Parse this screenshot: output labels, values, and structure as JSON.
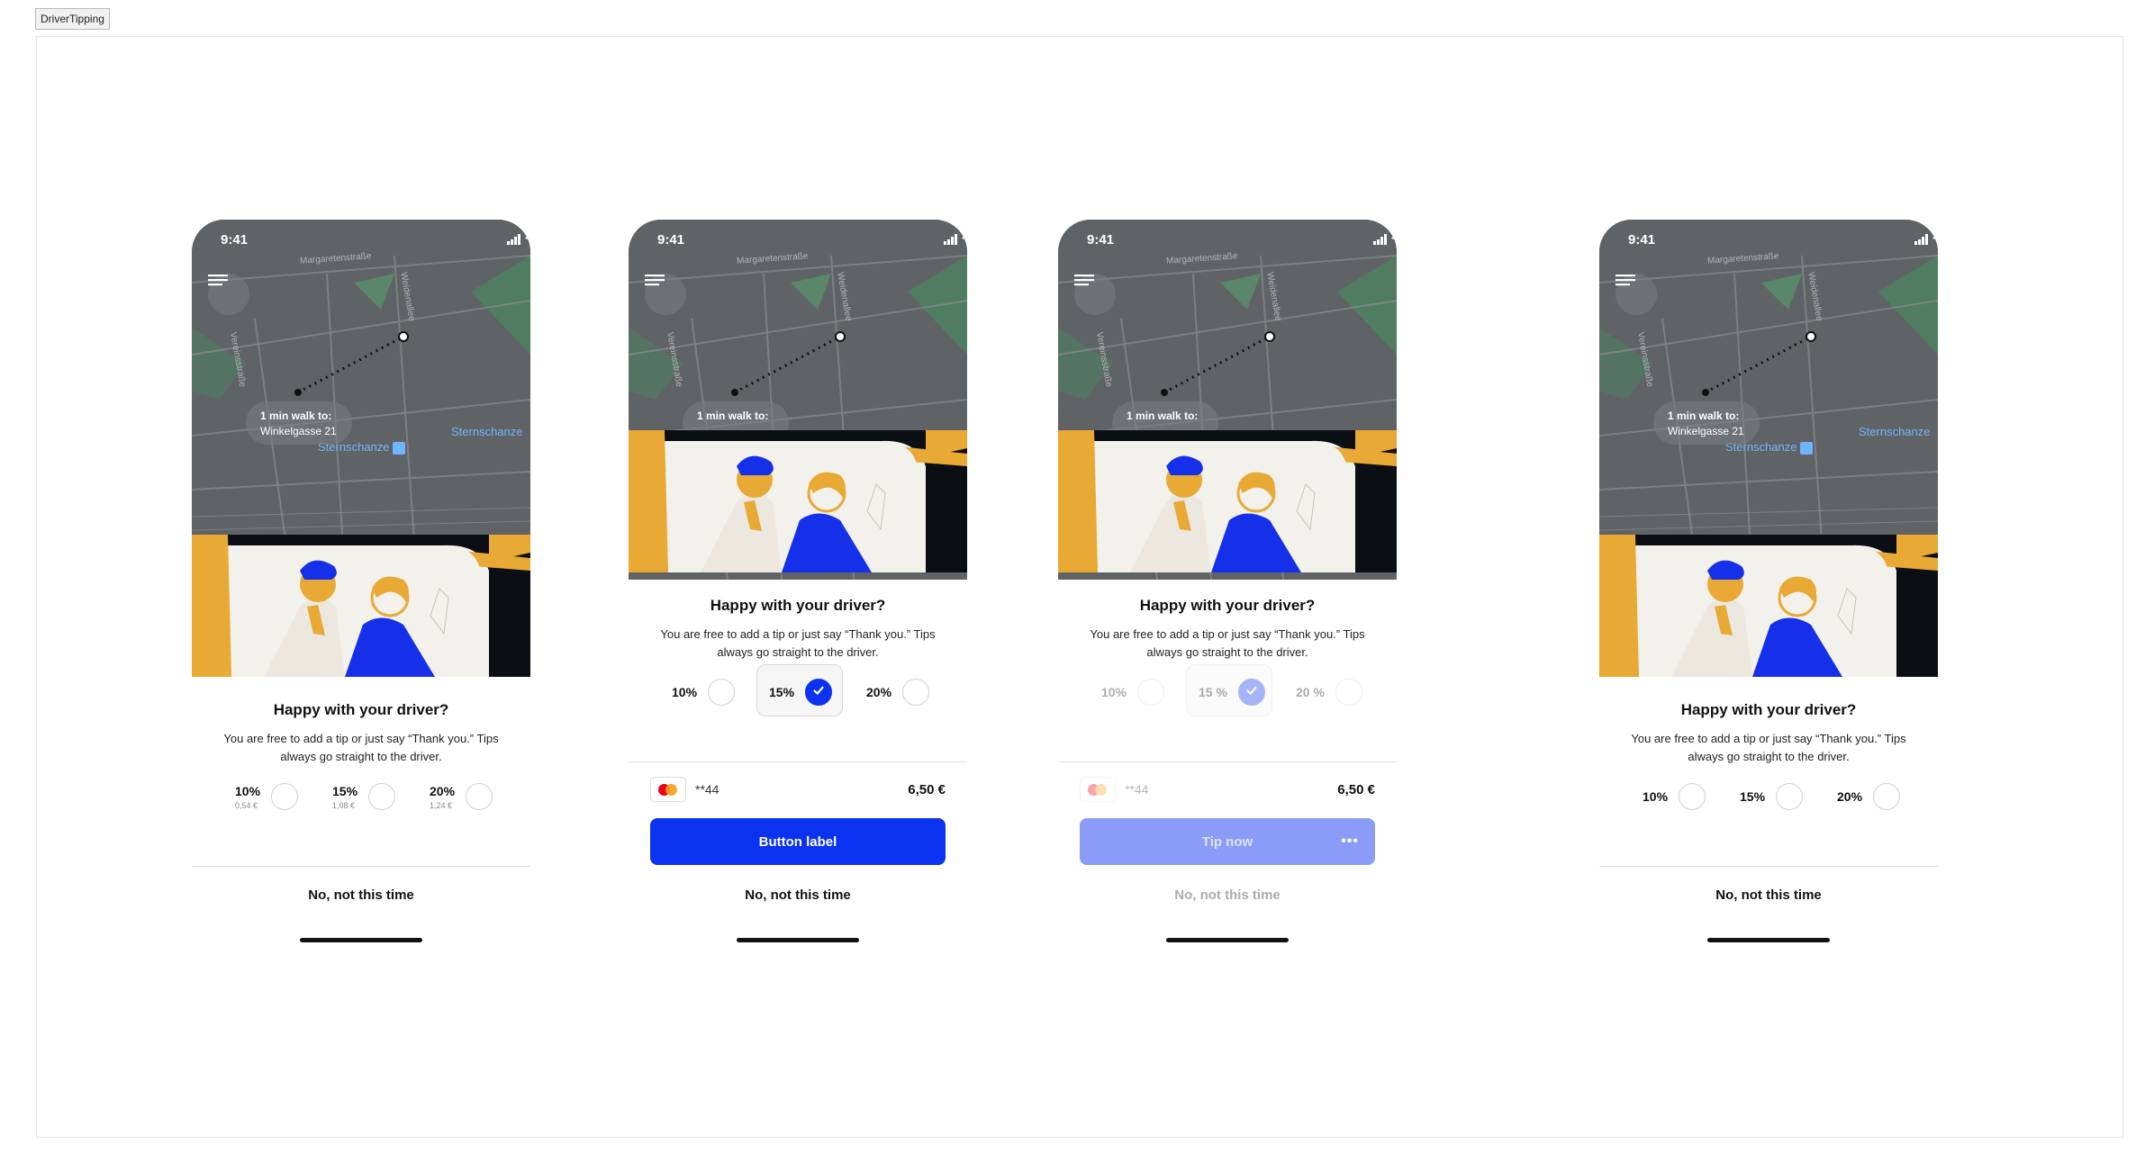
{
  "frame_label": "DriverTipping",
  "status": {
    "time": "9:41"
  },
  "map": {
    "streets": [
      "Margaretenstraße",
      "Weidenallee",
      "Vereinsstraße",
      "Sternschanze",
      "Sternschanze"
    ],
    "walk_title": "1 min walk to:",
    "walk_destination": "Winkelgasse 21"
  },
  "prompt": {
    "title": "Happy with your driver?",
    "description": "You are free to add a tip or just say “Thank you.” Tips always go straight to the driver."
  },
  "screen1": {
    "options": [
      {
        "label": "10%",
        "amount": "0,54 €"
      },
      {
        "label": "15%",
        "amount": "1,08 €"
      },
      {
        "label": "20%",
        "amount": "1,24 €"
      }
    ],
    "decline": "No, not this time"
  },
  "screen2": {
    "options": [
      {
        "label": "10%"
      },
      {
        "label": "15%"
      },
      {
        "label": "20%"
      }
    ],
    "selected_index": 1,
    "card_number": "**44",
    "amount": "6,50 €",
    "cta": "Button label",
    "decline": "No, not this time"
  },
  "screen3": {
    "options": [
      {
        "label": "10%"
      },
      {
        "label": "15 %"
      },
      {
        "label": "20 %"
      }
    ],
    "selected_index": 1,
    "card_number": "**44",
    "amount": "6,50 €",
    "cta": "Tip now",
    "loading_indicator": "•••",
    "decline": "No, not this time"
  },
  "screen4": {
    "options": [
      {
        "label": "10%"
      },
      {
        "label": "15%"
      },
      {
        "label": "20%"
      }
    ],
    "decline": "No, not this time"
  },
  "colors": {
    "accent": "#0a32f0",
    "accent_loading": "#8a9cf8",
    "taxi_yellow": "#e8a935",
    "map_bg": "#606366"
  },
  "icons": [
    "menu-icon",
    "signal-icon",
    "wifi-icon",
    "battery-icon",
    "check-icon",
    "mastercard-icon",
    "station-icon"
  ]
}
